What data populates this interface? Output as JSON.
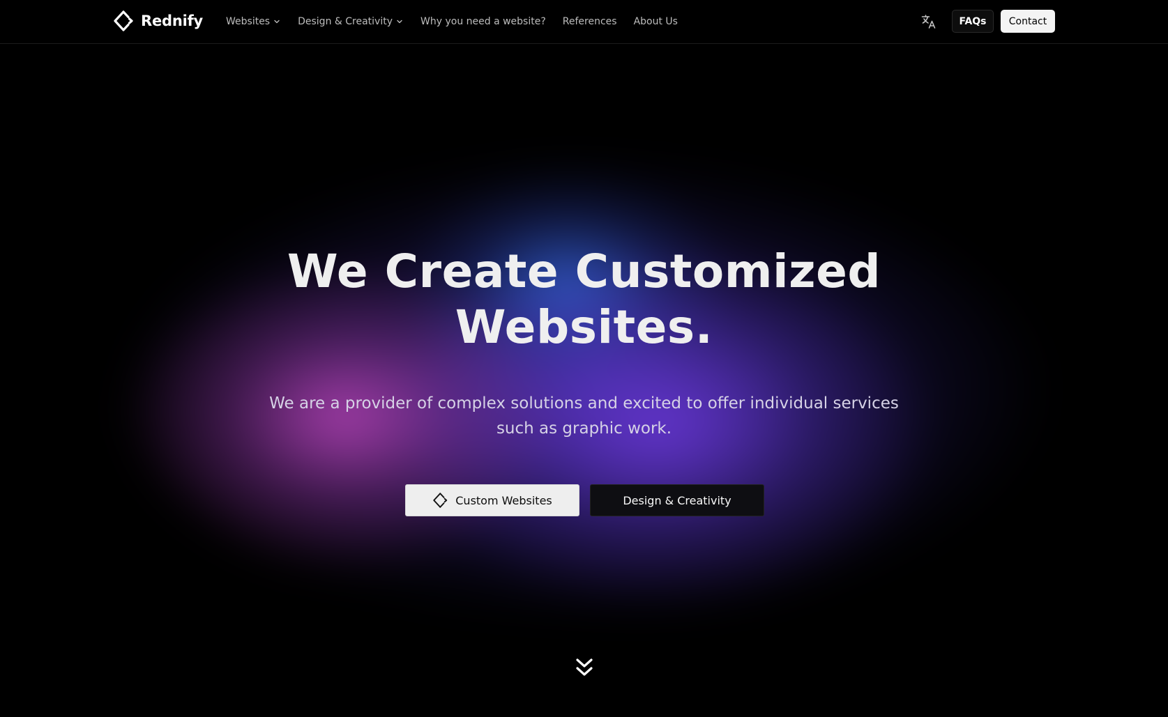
{
  "brand": {
    "name": "Rednify",
    "logo_icon": "rednify-diamond-logo-icon"
  },
  "nav": {
    "items": [
      {
        "label": "Websites",
        "has_dropdown": true
      },
      {
        "label": "Design & Creativity",
        "has_dropdown": true
      },
      {
        "label": "Why you need a website?",
        "has_dropdown": false
      },
      {
        "label": "References",
        "has_dropdown": false
      },
      {
        "label": "About Us",
        "has_dropdown": false
      }
    ],
    "translate_icon": "translate-icon",
    "faqs_label": "FAQs",
    "contact_label": "Contact"
  },
  "hero": {
    "title_lines": [
      "We Create Customized",
      "Websites."
    ],
    "subtitle_lines": [
      "We are a provider of complex solutions and excited to offer individual services",
      "such as graphic work."
    ],
    "primary_cta": "Custom Websites",
    "primary_cta_icon": "rednify-diamond-logo-icon",
    "secondary_cta": "Design & Creativity",
    "scroll_icon": "double-chevron-down-icon"
  },
  "colors": {
    "background": "#000000",
    "glow_pink": "#be46be",
    "glow_purple": "#6937d7",
    "glow_blue": "#326ee6",
    "primary_button_bg": "#eeeeee",
    "secondary_button_bg": "#0e0e12"
  }
}
